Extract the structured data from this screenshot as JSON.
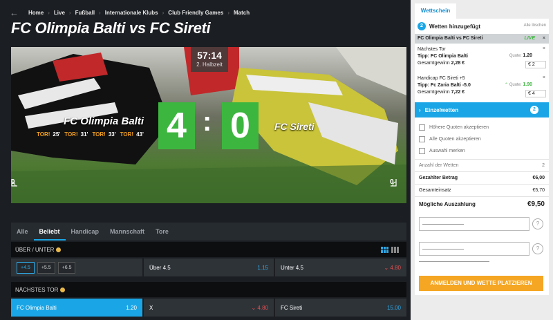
{
  "breadcrumb": {
    "back_icon": "arrow-left-icon",
    "items": [
      "Home",
      "Live",
      "Fußball",
      "Internationale Klubs",
      "Club Friendly Games",
      "Match"
    ]
  },
  "title": "FC Olimpia Balti vs FC Sireti",
  "scoreboard": {
    "time": "57:14",
    "period": "2. Halbzeit",
    "home_team": "FC Olimpia Balti",
    "away_team": "FC Sireti",
    "home_score": "4",
    "away_score": "0",
    "separator": ":",
    "goals": [
      {
        "label": "TOR!",
        "minute": "25'"
      },
      {
        "label": "TOR!",
        "minute": "31'"
      },
      {
        "label": "TOR!",
        "minute": "33'"
      },
      {
        "label": "TOR!",
        "minute": "43'"
      }
    ],
    "home_corners": "0",
    "away_corners": "0",
    "score_color": "#3db63f"
  },
  "market_tabs": [
    "Alle",
    "Beliebt",
    "Handicap",
    "Mannschaft",
    "Tore"
  ],
  "active_tab": "Beliebt",
  "over_under": {
    "title": "ÜBER / UNTER",
    "lines": [
      "+4.5",
      "+5.5",
      "+6.5"
    ],
    "selected_line": "+4.5",
    "over_label": "Über 4.5",
    "over_odds": "1.15",
    "under_label": "Unter 4.5",
    "under_odds": "4.80"
  },
  "next_goal": {
    "title": "NÄCHSTES TOR",
    "home_label": "FC Olimpia Balti",
    "home_odds": "1.20",
    "draw_label": "X",
    "draw_odds": "4.80",
    "away_label": "FC Sireti",
    "away_odds": "15.00"
  },
  "betslip": {
    "tab": "Wettschein",
    "added_count": "2",
    "added_label": "Wetten hinzugefügt",
    "clear_all": "Alle löschen",
    "match": "FC Olimpia Balti vs FC Sireti",
    "live": "LIVE",
    "bets": [
      {
        "market": "Nächstes Tor",
        "tip": "Tipp: FC Olimpia Balti",
        "quote_label": "Quote:",
        "quote": "1.20",
        "total_label": "Gesamtgewinn",
        "total": "2,28 €",
        "stake": "€  2"
      },
      {
        "market": "Handicap FC Sireti +5",
        "tip": "Tipp: Fc Zaria Balti -5.0",
        "quote_label": "Quote:",
        "quote": "1.90",
        "total_label": "Gesamtgewinn",
        "total": "7,22 €",
        "stake": "€  4"
      }
    ],
    "singles_label": "Einzelwetten",
    "singles_count": "2",
    "options": [
      "Höhere Quoten akzeptieren",
      "Alle Quoten akzeptieren",
      "Auswahl merken"
    ],
    "summary": [
      {
        "label": "Anzahl der Wetten",
        "value": "2"
      },
      {
        "label": "Gezahlter Betrag",
        "value": "€6,00"
      },
      {
        "label": "Gesamteinsatz",
        "value": "€5,70"
      },
      {
        "label": "Mögliche Auszahlung",
        "value": "€9,50"
      }
    ],
    "help": "?",
    "cta": "ANMELDEN UND WETTE PLATZIEREN",
    "accent": "#1aa6e6",
    "cta_color": "#f5a623"
  }
}
